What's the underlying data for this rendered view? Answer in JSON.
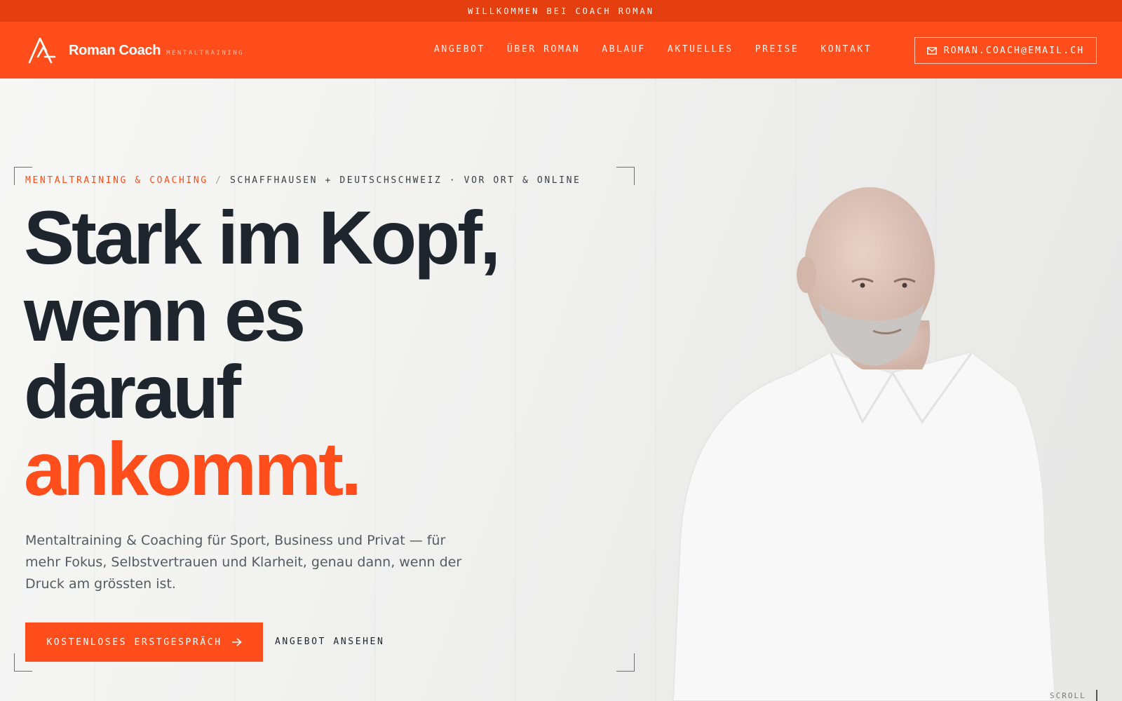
{
  "topbar": {
    "text": "WILLKOMMEN BEI COACH ROMAN"
  },
  "nav": {
    "brand": "Roman Coach",
    "brand_sub": "MENTALTRAINING",
    "items": [
      "ANGEBOT",
      "ÜBER ROMAN",
      "ABLAUF",
      "AKTUELLES",
      "PREISE",
      "KONTAKT"
    ],
    "email_button": "ROMAN.COACH@EMAIL.CH"
  },
  "hero": {
    "kicker_primary": "MENTALTRAINING & COACHING",
    "kicker_separator": "/",
    "kicker_secondary": "SCHAFFHAUSEN + DEUTSCHSCHWEIZ · VOR ORT & ONLINE",
    "headline_lines": [
      "Stark im Kopf,",
      "wenn es",
      "darauf"
    ],
    "headline_accent": "ankommt.",
    "lead": "Mentaltraining & Coaching für Sport, Business und Privat — für mehr Fokus, Selbstvertrauen und Klarheit, genau dann, wenn der Druck am grössten ist.",
    "cta_primary": "KOSTENLOSES ERSTGESPRÄCH",
    "cta_secondary": "ANGEBOT ANSEHEN",
    "scroll_label": "SCROLL"
  },
  "colors": {
    "accent": "#ff4e1c",
    "topbar": "#e53e0f",
    "ink": "#1e252c"
  },
  "icons": [
    "logo-mark-icon",
    "mail-icon",
    "arrow-right-icon"
  ]
}
